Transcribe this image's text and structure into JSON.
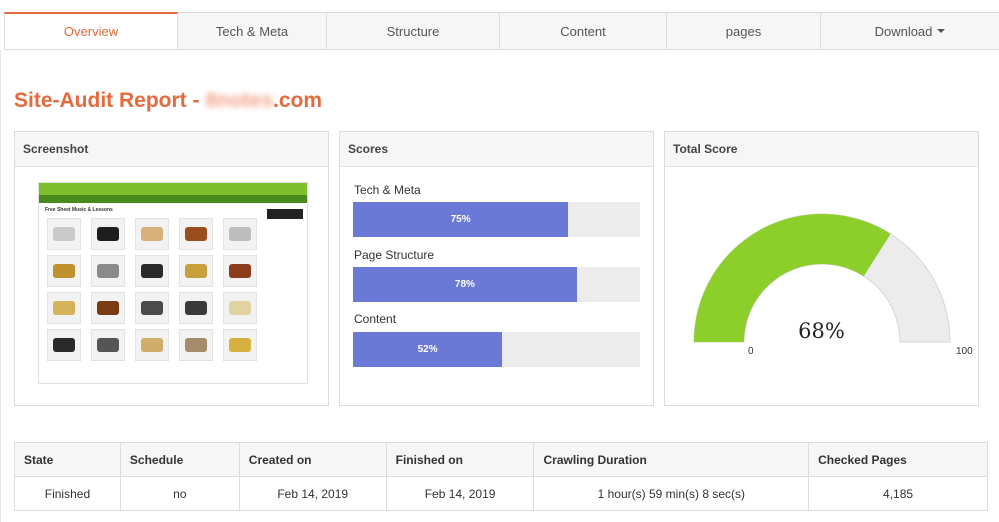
{
  "tabs": [
    {
      "label": "Overview",
      "active": true
    },
    {
      "label": "Tech & Meta",
      "active": false
    },
    {
      "label": "Structure",
      "active": false
    },
    {
      "label": "Content",
      "active": false
    },
    {
      "label": "pages",
      "active": false
    },
    {
      "label": "Download",
      "active": false
    }
  ],
  "report": {
    "title_prefix": "Site-Audit Report - ",
    "domain_blurred": "8notes",
    "domain_suffix": ".com"
  },
  "panels": {
    "screenshot_title": "Screenshot",
    "scores_title": "Scores",
    "total_title": "Total Score"
  },
  "screenshot": {
    "heading": "Free Sheet Music & Lessons"
  },
  "scores": [
    {
      "label": "Tech & Meta",
      "value": 75,
      "display": "75%"
    },
    {
      "label": "Page Structure",
      "value": 78,
      "display": "78%"
    },
    {
      "label": "Content",
      "value": 52,
      "display": "52%"
    }
  ],
  "total_score": {
    "value": 68,
    "display": "68%",
    "min_label": "0",
    "max_label": "100",
    "fill_color": "#8ccf2a",
    "track_color": "#ececec"
  },
  "colors": {
    "accent": "#e8693c",
    "bar": "#6a79d6"
  },
  "table": {
    "headers": [
      "State",
      "Schedule",
      "Created on",
      "Finished on",
      "Crawling Duration",
      "Checked Pages"
    ],
    "row": [
      "Finished",
      "no",
      "Feb 14, 2019",
      "Feb 14, 2019",
      "1 hour(s) 59 min(s) 8 sec(s)",
      "4,185"
    ]
  }
}
